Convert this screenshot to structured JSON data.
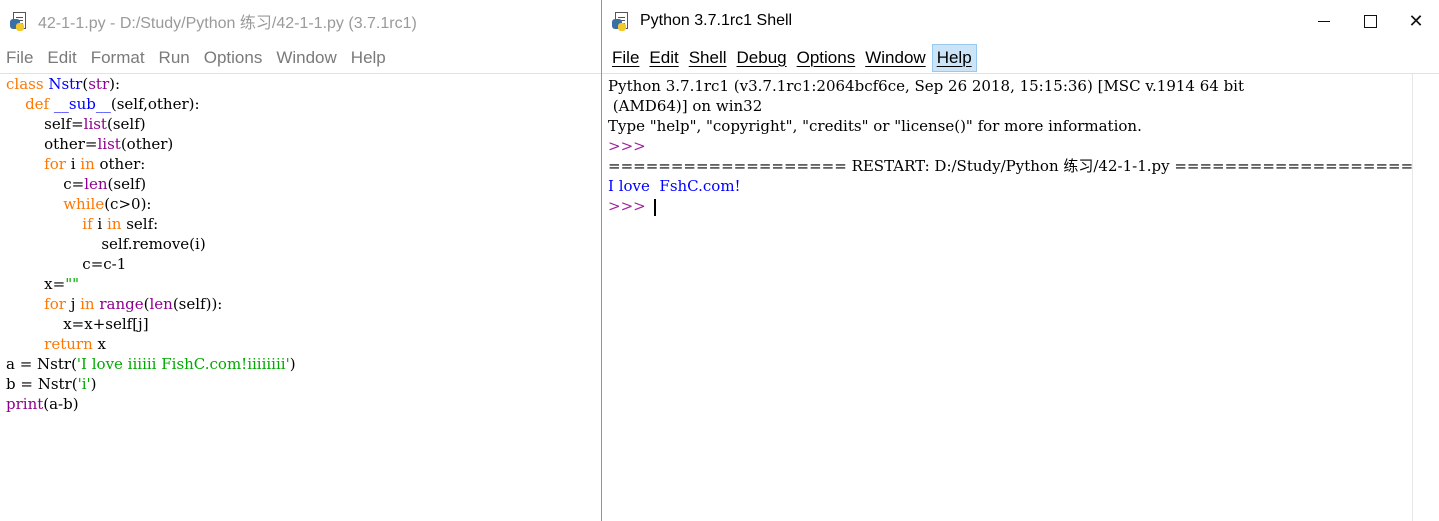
{
  "editor": {
    "title": "42-1-1.py - D:/Study/Python 练习/42-1-1.py (3.7.1rc1)",
    "menu": [
      "File",
      "Edit",
      "Format",
      "Run",
      "Options",
      "Window",
      "Help"
    ],
    "code": [
      [
        [
          "kw",
          "class"
        ],
        [
          "t",
          " "
        ],
        [
          "def",
          "Nstr"
        ],
        [
          "t",
          "("
        ],
        [
          "bi",
          "str"
        ],
        [
          "t",
          "):"
        ]
      ],
      [
        [
          "t",
          "    "
        ],
        [
          "kw",
          "def"
        ],
        [
          "t",
          " "
        ],
        [
          "def",
          "__sub__"
        ],
        [
          "t",
          "(self,other):"
        ]
      ],
      [
        [
          "t",
          "        self="
        ],
        [
          "bi",
          "list"
        ],
        [
          "t",
          "(self)"
        ]
      ],
      [
        [
          "t",
          "        other="
        ],
        [
          "bi",
          "list"
        ],
        [
          "t",
          "(other)"
        ]
      ],
      [
        [
          "t",
          "        "
        ],
        [
          "kw",
          "for"
        ],
        [
          "t",
          " i "
        ],
        [
          "kw",
          "in"
        ],
        [
          "t",
          " other:"
        ]
      ],
      [
        [
          "t",
          "            c="
        ],
        [
          "bi",
          "len"
        ],
        [
          "t",
          "(self)"
        ]
      ],
      [
        [
          "t",
          "            "
        ],
        [
          "kw",
          "while"
        ],
        [
          "t",
          "(c>0):"
        ]
      ],
      [
        [
          "t",
          "                "
        ],
        [
          "kw",
          "if"
        ],
        [
          "t",
          " i "
        ],
        [
          "kw",
          "in"
        ],
        [
          "t",
          " self:"
        ]
      ],
      [
        [
          "t",
          "                    self.remove(i)"
        ]
      ],
      [
        [
          "t",
          "                c=c-1"
        ]
      ],
      [
        [
          "t",
          "        x="
        ],
        [
          "str",
          "\"\""
        ]
      ],
      [
        [
          "t",
          "        "
        ],
        [
          "kw",
          "for"
        ],
        [
          "t",
          " j "
        ],
        [
          "kw",
          "in"
        ],
        [
          "t",
          " "
        ],
        [
          "bi",
          "range"
        ],
        [
          "t",
          "("
        ],
        [
          "bi",
          "len"
        ],
        [
          "t",
          "(self)):"
        ]
      ],
      [
        [
          "t",
          "            x=x+self[j]"
        ]
      ],
      [
        [
          "t",
          "        "
        ],
        [
          "kw",
          "return"
        ],
        [
          "t",
          " x"
        ]
      ],
      [
        [
          "t",
          "a = Nstr("
        ],
        [
          "str",
          "'I love iiiiii FishC.com!iiiiiiii'"
        ],
        [
          "t",
          ")"
        ]
      ],
      [
        [
          "t",
          "b = Nstr("
        ],
        [
          "str",
          "'i'"
        ],
        [
          "t",
          ")"
        ]
      ],
      [
        [
          "bi",
          "print"
        ],
        [
          "t",
          "(a-b)"
        ]
      ]
    ]
  },
  "shell": {
    "title": "Python 3.7.1rc1 Shell",
    "menu": [
      "File",
      "Edit",
      "Shell",
      "Debug",
      "Options",
      "Window",
      "Help"
    ],
    "active_menu": "Help",
    "lines": [
      [
        [
          "t",
          "Python 3.7.1rc1 (v3.7.1rc1:2064bcf6ce, Sep 26 2018, 15:15:36) [MSC v.1914 64 bit"
        ]
      ],
      [
        [
          "t",
          " (AMD64)] on win32"
        ]
      ],
      [
        [
          "t",
          "Type \"help\", \"copyright\", \"credits\" or \"license()\" for more information."
        ]
      ],
      [
        [
          "prompt",
          ">>>"
        ]
      ],
      [
        [
          "t",
          "=================== RESTART: D:/Study/Python 练习/42-1-1.py ==================="
        ]
      ],
      [
        [
          "out",
          "I love  FshC.com!"
        ]
      ],
      [
        [
          "prompt",
          ">>> "
        ],
        [
          "cursor",
          ""
        ]
      ]
    ]
  },
  "window_controls": {
    "minimize": "—",
    "maximize": "☐",
    "close": "✕"
  },
  "colors": {
    "keyword": "#ff7700",
    "builtin": "#900090",
    "string": "#00aa00",
    "definition": "#0000ff",
    "prompt": "#a020a0",
    "stdout": "#0000ff"
  }
}
